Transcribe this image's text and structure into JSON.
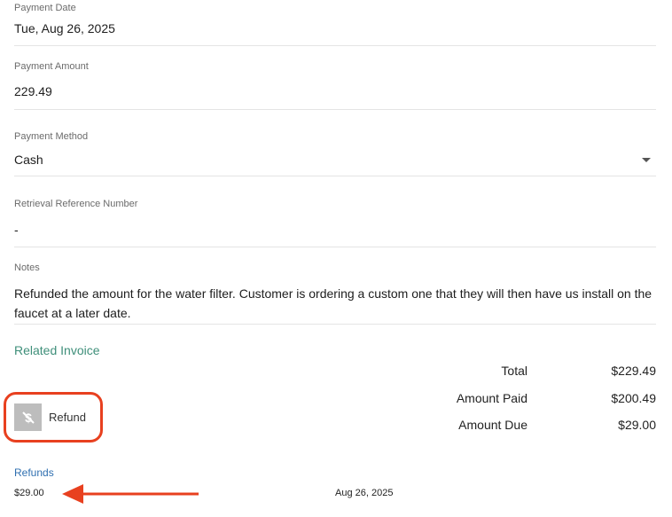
{
  "payment_date": {
    "label": "Payment Date",
    "value": "Tue, Aug 26, 2025"
  },
  "payment_amount": {
    "label": "Payment Amount",
    "value": "229.49"
  },
  "payment_method": {
    "label": "Payment Method",
    "value": "Cash",
    "icon": "chevron-down-icon"
  },
  "retrieval_reference": {
    "label": "Retrieval Reference Number",
    "value": "-"
  },
  "notes": {
    "label": "Notes",
    "value": "Refunded the amount for the water filter. Customer is ordering a custom one that they will then have us install on the faucet at a later date."
  },
  "related_invoice": {
    "label": "Related Invoice"
  },
  "summary": {
    "total_label": "Total",
    "total_value": "$229.49",
    "paid_label": "Amount Paid",
    "paid_value": "$200.49",
    "due_label": "Amount Due",
    "due_value": "$29.00"
  },
  "refund_button": {
    "label": "Refund",
    "icon": "refund-icon"
  },
  "refunds": {
    "heading": "Refunds",
    "rows": [
      {
        "amount": "$29.00",
        "date": "Aug 26, 2025"
      }
    ]
  },
  "colors": {
    "accent_green": "#3f8f7a",
    "link_blue": "#2f6fb0",
    "annotation_red": "#e8401f"
  }
}
